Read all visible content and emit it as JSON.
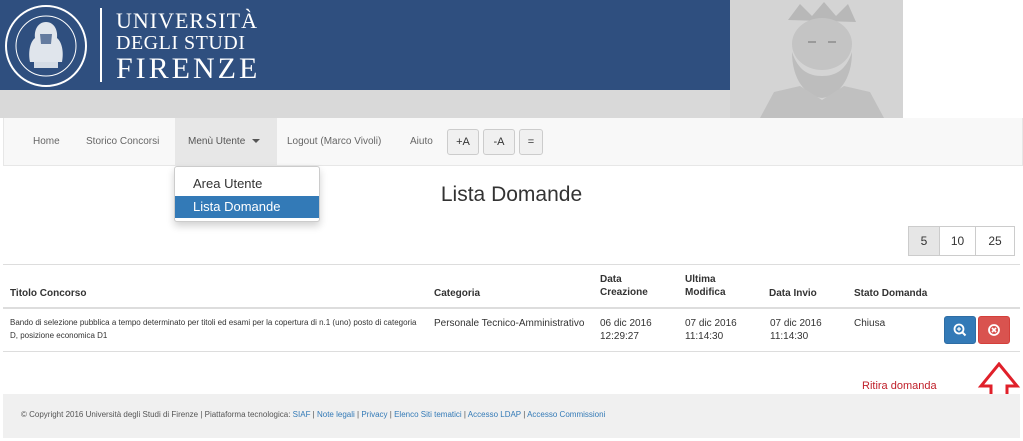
{
  "header": {
    "logo": {
      "line1": "UNIVERSITÀ",
      "line2": "DEGLI STUDI",
      "line3": "FIRENZE",
      "seal_text": "FLORENTINA STUDIORUM UNIVERSITAS"
    },
    "colors": {
      "blue": "#2f4f7f",
      "gray": "#d9d9d9"
    }
  },
  "nav": {
    "home": "Home",
    "storico": "Storico Concorsi",
    "menu_utente": "Menù Utente",
    "logout": "Logout (Marco Vivoli)",
    "aiuto": "Aiuto",
    "font_increase": "+A",
    "font_decrease": "-A",
    "font_reset": "="
  },
  "dropdown": {
    "items": [
      {
        "label": "Area Utente"
      },
      {
        "label": "Lista Domande"
      }
    ],
    "selected": "Lista Domande"
  },
  "page": {
    "title": "Lista Domande"
  },
  "pagination": {
    "options": [
      "5",
      "10",
      "25"
    ],
    "selected": "5"
  },
  "table": {
    "headers": {
      "titolo": "Titolo Concorso",
      "categoria": "Categoria",
      "data_creazione": "Data Creazione",
      "ultima_modifica": "Ultima Modifica",
      "data_invio": "Data Invio",
      "stato": "Stato Domanda"
    },
    "rows": [
      {
        "titolo": "Bando di selezione pubblica a tempo determinato per titoli ed esami per la copertura di n.1 (uno) posto di categoria D, posizione economica D1",
        "categoria": "Personale Tecnico-Amministrativo",
        "data_creazione_date": "06 dic 2016",
        "data_creazione_time": "12:29:27",
        "ultima_modifica_date": "07 dic 2016",
        "ultima_modifica_time": "11:14:30",
        "data_invio_date": "07 dic 2016",
        "data_invio_time": "11:14:30",
        "stato": "Chiusa"
      }
    ]
  },
  "annotation": {
    "text": "Ritira domanda"
  },
  "footer": {
    "prefix": "© Copyright 2016 Università degli Studi di Firenze | Piattaforma tecnologica: ",
    "siaf": "SIAF",
    "sep1": " | ",
    "note_legali": "Note legali",
    "sep2": " | ",
    "privacy": "Privacy",
    "sep3": " | ",
    "elenco": "Elenco Siti tematici",
    "sep4": " | ",
    "ldap": "Accesso LDAP",
    "sep5": " | ",
    "commissioni": "Accesso Commissioni"
  },
  "icons": {
    "view": "zoom-in-icon",
    "withdraw": "remove-circle-icon",
    "caret": "caret-down-icon",
    "arrow": "arrow-up-outline-icon"
  }
}
